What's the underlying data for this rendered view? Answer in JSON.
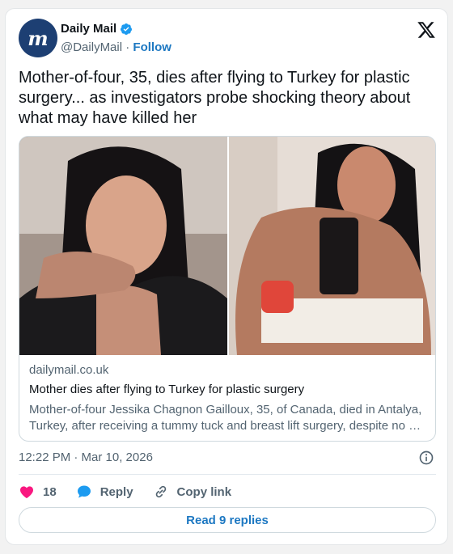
{
  "author": {
    "avatar_text": "m",
    "name": "Daily Mail",
    "handle": "@DailyMail",
    "separator": "·",
    "follow_label": "Follow"
  },
  "tweet": {
    "text": "Mother-of-four, 35, dies after flying to Turkey for plastic surgery... as investigators probe shocking theory about what may have killed her"
  },
  "link_card": {
    "domain": "dailymail.co.uk",
    "title": "Mother dies after flying to Turkey for plastic surgery",
    "description": "Mother-of-four Jessika Chagnon Gailloux, 35, of Canada, died in Antalya, Turkey, after receiving a tummy tuck and breast lift surgery, despite no …"
  },
  "timestamp": "12:22 PM · Mar 10, 2026",
  "actions": {
    "like_count": "18",
    "reply_label": "Reply",
    "copy_link_label": "Copy link"
  },
  "replies_button_label": "Read 9 replies",
  "colors": {
    "accent": "#1d78c2",
    "like": "#f91880",
    "reply": "#1d9bf0",
    "avatar_bg": "#1d3f73"
  }
}
